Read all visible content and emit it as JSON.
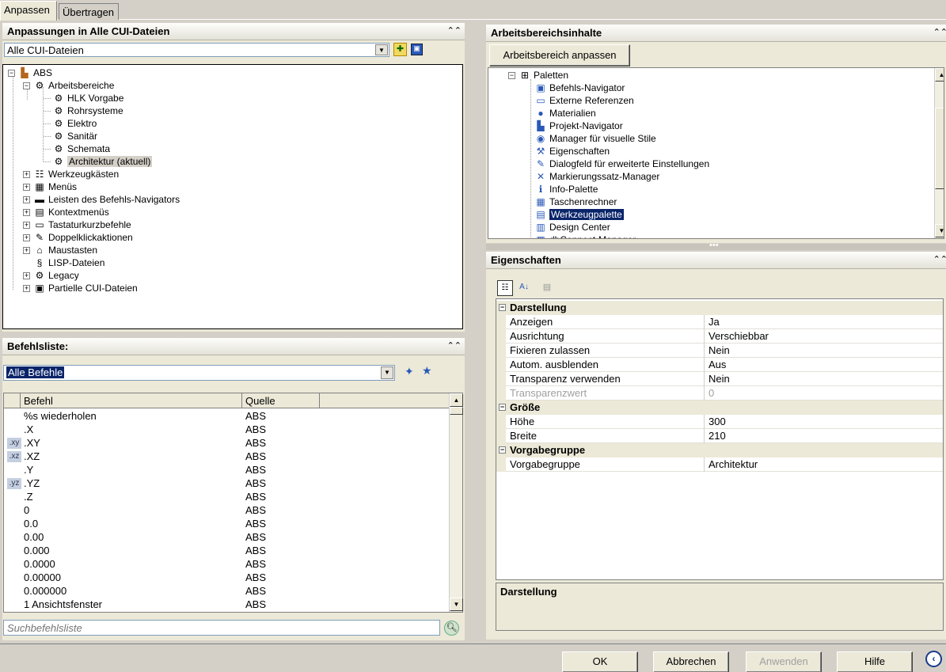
{
  "tabs": [
    "Anpassen",
    "Übertragen"
  ],
  "left_top": {
    "title": "Anpassungen in Alle CUI-Dateien",
    "combo_value": "Alle CUI-Dateien",
    "tree": {
      "root": "ABS",
      "workspaces_label": "Arbeitsbereiche",
      "workspaces": [
        "HLK Vorgabe",
        "Rohrsysteme",
        "Elektro",
        "Sanitär",
        "Schemata",
        "Architektur (aktuell)"
      ],
      "items": [
        "Werkzeugkästen",
        "Menüs",
        "Leisten des Befehls-Navigators",
        "Kontextmenüs",
        "Tastaturkurzbefehle",
        "Doppelklickaktionen",
        "Maustasten",
        "LISP-Dateien",
        "Legacy",
        "Partielle CUI-Dateien"
      ]
    }
  },
  "commands": {
    "title": "Befehlsliste:",
    "filter": "Alle Befehle",
    "col_command": "Befehl",
    "col_source": "Quelle",
    "rows": [
      {
        "pre": "",
        "name": "%s wiederholen",
        "src": "ABS"
      },
      {
        "pre": "",
        "name": ".X",
        "src": "ABS"
      },
      {
        "pre": ".xy",
        "name": ".XY",
        "src": "ABS"
      },
      {
        "pre": ".xz",
        "name": ".XZ",
        "src": "ABS"
      },
      {
        "pre": "",
        "name": ".Y",
        "src": "ABS"
      },
      {
        "pre": ".yz",
        "name": ".YZ",
        "src": "ABS"
      },
      {
        "pre": "",
        "name": ".Z",
        "src": "ABS"
      },
      {
        "pre": "",
        "name": "0",
        "src": "ABS"
      },
      {
        "pre": "",
        "name": "0.0",
        "src": "ABS"
      },
      {
        "pre": "",
        "name": "0.00",
        "src": "ABS"
      },
      {
        "pre": "",
        "name": "0.000",
        "src": "ABS"
      },
      {
        "pre": "",
        "name": "0.0000",
        "src": "ABS"
      },
      {
        "pre": "",
        "name": "0.00000",
        "src": "ABS"
      },
      {
        "pre": "",
        "name": "0.000000",
        "src": "ABS"
      },
      {
        "pre": "",
        "name": "1 Ansichtsfenster",
        "src": "ABS"
      }
    ],
    "search_placeholder": "Suchbefehlsliste"
  },
  "workspace": {
    "title": "Arbeitsbereichsinhalte",
    "customize_button": "Arbeitsbereich anpassen",
    "palettes_label": "Paletten",
    "palettes": [
      "Befehls-Navigator",
      "Externe Referenzen",
      "Materialien",
      "Projekt-Navigator",
      "Manager für visuelle Stile",
      "Eigenschaften",
      "Dialogfeld für erweiterte Einstellungen",
      "Markierungssatz-Manager",
      "Info-Palette",
      "Taschenrechner",
      "Werkzeugpalette",
      "Design Center",
      "dbConnect-Manager"
    ]
  },
  "properties": {
    "title": "Eigenschaften",
    "sections": [
      {
        "name": "Darstellung",
        "rows": [
          {
            "k": "Anzeigen",
            "v": "Ja",
            "disabled": false
          },
          {
            "k": "Ausrichtung",
            "v": "Verschiebbar",
            "disabled": false
          },
          {
            "k": "Fixieren zulassen",
            "v": "Nein",
            "disabled": false
          },
          {
            "k": "Autom. ausblenden",
            "v": "Aus",
            "disabled": false
          },
          {
            "k": "Transparenz verwenden",
            "v": "Nein",
            "disabled": false
          },
          {
            "k": "Transparenzwert",
            "v": "0",
            "disabled": true
          }
        ]
      },
      {
        "name": "Größe",
        "rows": [
          {
            "k": "Höhe",
            "v": "300",
            "disabled": false
          },
          {
            "k": "Breite",
            "v": "210",
            "disabled": false
          }
        ]
      },
      {
        "name": "Vorgabegruppe",
        "rows": [
          {
            "k": "Vorgabegruppe",
            "v": "Architektur",
            "disabled": false
          }
        ]
      }
    ],
    "description_title": "Darstellung"
  },
  "footer": {
    "ok": "OK",
    "cancel": "Abbrechen",
    "apply": "Anwenden",
    "help": "Hilfe"
  }
}
